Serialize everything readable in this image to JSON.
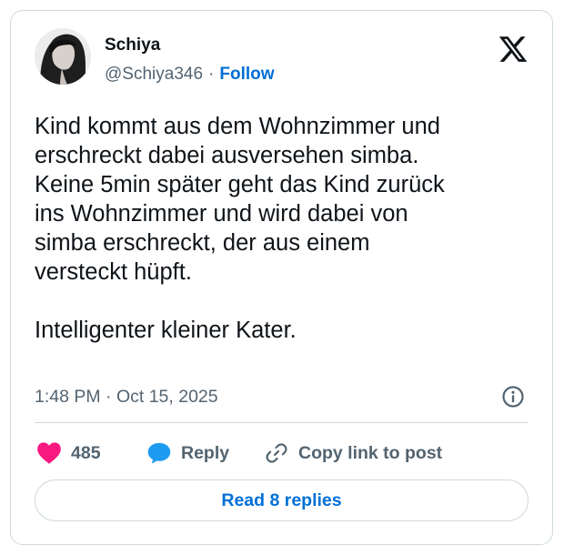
{
  "author": {
    "display_name": "Schiya",
    "handle": "@Schiya346",
    "separator": "·",
    "follow_label": "Follow"
  },
  "tweet": {
    "text": "Kind kommt aus dem Wohnzimmer und\nerschreckt dabei ausversehen simba.\nKeine 5min später geht das Kind zurück\nins Wohnzimmer und wird dabei von\nsimba erschreckt, der aus einem\nversteckt hüpft.\n\nIntelligenter kleiner Kater.",
    "timestamp": "1:48 PM · Oct 15, 2025"
  },
  "actions": {
    "like_count": "485",
    "reply_label": "Reply",
    "copy_label": "Copy link to post"
  },
  "footer": {
    "read_replies_label": "Read 8 replies"
  },
  "icons": {
    "brand": "x-logo-icon",
    "info": "info-icon",
    "like": "heart-icon",
    "reply": "speech-bubble-icon",
    "copy": "link-icon"
  },
  "colors": {
    "link_blue": "#006fd6",
    "like_pink": "#f91880",
    "reply_blue": "#1d9bf0",
    "muted_gray": "#536471",
    "text_dark": "#0f1419",
    "border": "#cfd9de"
  }
}
